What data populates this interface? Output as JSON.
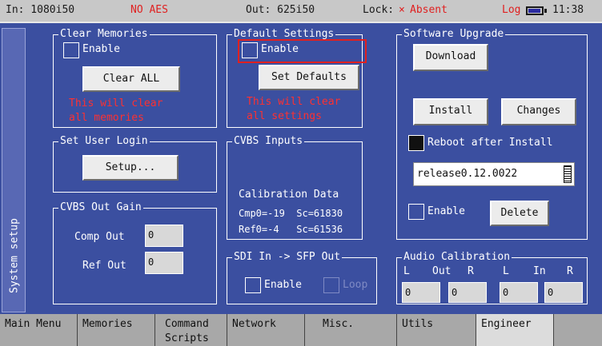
{
  "status": {
    "input": "In: 1080i50",
    "aes": "NO AES",
    "output": "Out: 625i50",
    "lock_label": "Lock:",
    "lock_symbol": "×",
    "lock_value": "Absent",
    "log": "Log",
    "time": "11:38"
  },
  "side_tab": {
    "label": "System setup"
  },
  "clear_memories": {
    "title": "Clear Memories",
    "enable_label": "Enable",
    "button": "Clear ALL",
    "warning_line1": "This will clear",
    "warning_line2": "all memories"
  },
  "default_settings": {
    "title": "Default Settings",
    "enable_label": "Enable",
    "button": "Set Defaults",
    "warning_line1": "This will clear",
    "warning_line2": "all settings"
  },
  "software_upgrade": {
    "title": "Software Upgrade",
    "download": "Download",
    "install": "Install",
    "changes": "Changes",
    "reboot_label": "Reboot after Install",
    "reboot_checked": true,
    "release_value": "release0.12.0022",
    "enable_label": "Enable",
    "delete": "Delete"
  },
  "set_user_login": {
    "title": "Set User Login",
    "button": "Setup..."
  },
  "cvbs_inputs": {
    "title": "CVBS Inputs",
    "calibration_heading": "Calibration Data",
    "line1": "Cmp0=-19  Sc=61830",
    "line2": "Ref0=-4   Sc=61536"
  },
  "cvbs_out_gain": {
    "title": "CVBS Out Gain",
    "comp_label": "Comp Out",
    "comp_value": "0",
    "ref_label": "Ref Out",
    "ref_value": "0"
  },
  "sdi_sfp": {
    "title": "SDI In -> SFP Out",
    "enable_label": "Enable",
    "loop_label": "Loop"
  },
  "audio_calibration": {
    "title": "Audio Calibration",
    "h_l1": "L",
    "h_out": "Out",
    "h_r1": "R",
    "h_l2": "L",
    "h_in": "In",
    "h_r2": "R",
    "values": [
      "0",
      "0",
      "0",
      "0"
    ]
  },
  "tabs": [
    {
      "label": "Main Menu"
    },
    {
      "label": "Memories"
    },
    {
      "label": "Command Scripts"
    },
    {
      "label": "Network"
    },
    {
      "label": "Misc."
    },
    {
      "label": "Utils"
    },
    {
      "label": "Engineer"
    }
  ]
}
